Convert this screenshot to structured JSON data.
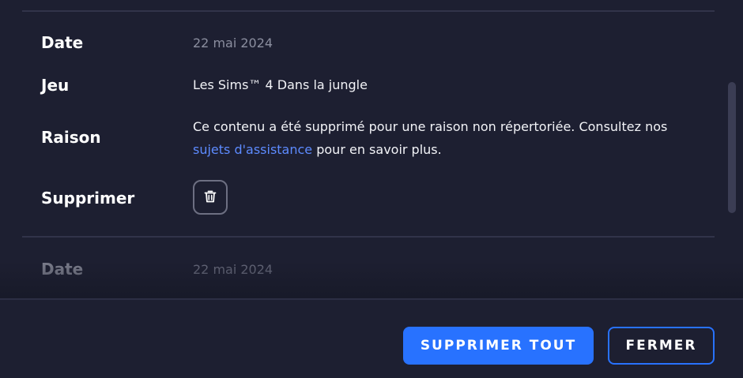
{
  "records": [
    {
      "date_label": "Date",
      "date_value": "22 mai 2024",
      "game_label": "Jeu",
      "game_value": "Les Sims™ 4 Dans la jungle",
      "reason_label": "Raison",
      "reason_text_before": "Ce contenu a été supprimé pour une raison non répertoriée. Consultez nos ",
      "reason_link": "sujets d'assistance",
      "reason_text_after": " pour en savoir plus.",
      "delete_label": "Supprimer",
      "delete_icon": "trash-icon"
    },
    {
      "date_label": "Date",
      "date_value": "22 mai 2024"
    }
  ],
  "footer": {
    "delete_all_label": "SUPPRIMER TOUT",
    "close_label": "FERMER"
  },
  "colors": {
    "background": "#1d1f31",
    "accent": "#2872ff",
    "link": "#5d8bff",
    "muted_text": "#8b8e9f"
  }
}
